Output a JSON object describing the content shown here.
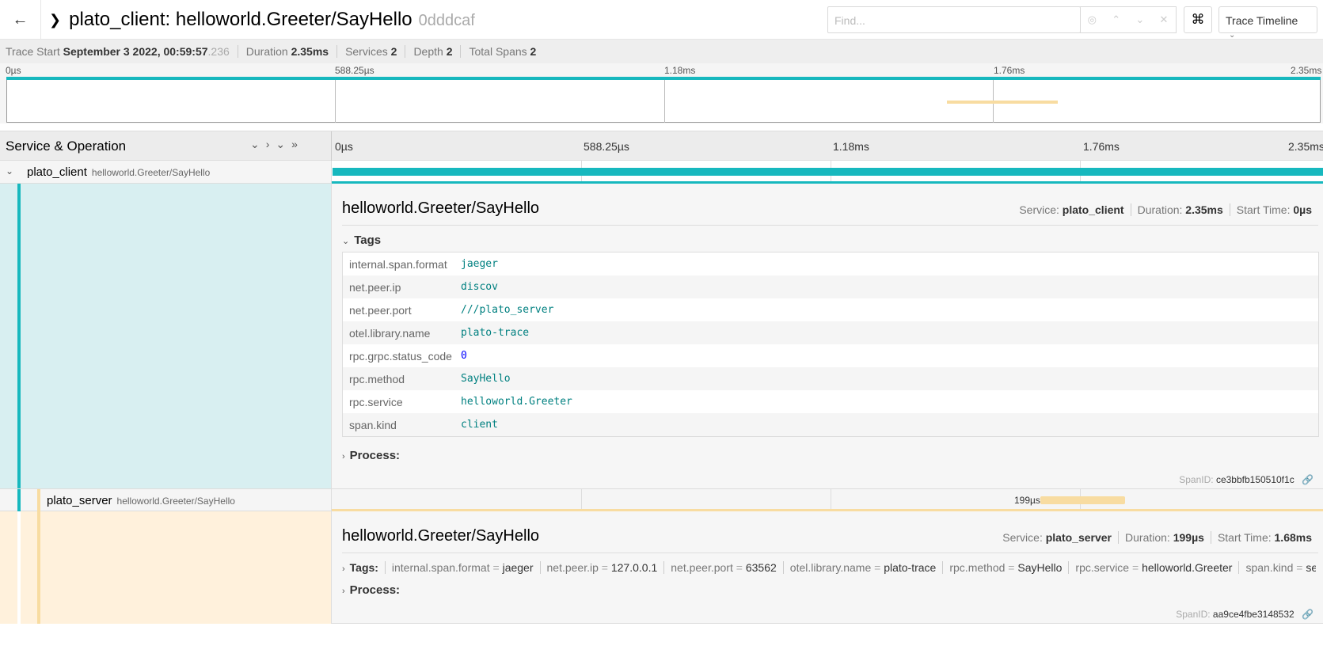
{
  "header": {
    "title_service": "plato_client: helloworld.Greeter/SayHello",
    "trace_id": "0dddcaf",
    "find_placeholder": "Find...",
    "view_label": "Trace Timeline"
  },
  "summary": {
    "trace_start_label": "Trace Start",
    "trace_start_value": "September 3 2022, 00:59:57",
    "trace_start_ms": ".236",
    "duration_label": "Duration",
    "duration_value": "2.35ms",
    "services_label": "Services",
    "services_value": "2",
    "depth_label": "Depth",
    "depth_value": "2",
    "total_spans_label": "Total Spans",
    "total_spans_value": "2"
  },
  "ticks": [
    "0µs",
    "588.25µs",
    "1.18ms",
    "1.76ms",
    "2.35ms"
  ],
  "timeline_header": {
    "label": "Service & Operation"
  },
  "spans": [
    {
      "service": "plato_client",
      "operation": "helloworld.Greeter/SayHello",
      "start_fraction": 0.0,
      "duration_fraction": 1.0,
      "color": "#17b8be",
      "detail": {
        "title": "helloworld.Greeter/SayHello",
        "service_label": "Service:",
        "service_value": "plato_client",
        "duration_label": "Duration:",
        "duration_value": "2.35ms",
        "start_label": "Start Time:",
        "start_value": "0µs",
        "tags_label": "Tags",
        "tags": [
          {
            "key": "internal.span.format",
            "value": "jaeger"
          },
          {
            "key": "net.peer.ip",
            "value": "discov"
          },
          {
            "key": "net.peer.port",
            "value": "///plato_server"
          },
          {
            "key": "otel.library.name",
            "value": "plato-trace"
          },
          {
            "key": "rpc.grpc.status_code",
            "value": "0"
          },
          {
            "key": "rpc.method",
            "value": "SayHello"
          },
          {
            "key": "rpc.service",
            "value": "helloworld.Greeter"
          },
          {
            "key": "span.kind",
            "value": "client"
          }
        ],
        "process_label": "Process:",
        "spanid_label": "SpanID:",
        "spanid_value": "ce3bbfb150510f1c"
      }
    },
    {
      "service": "plato_server",
      "operation": "helloworld.Greeter/SayHello",
      "start_fraction": 0.715,
      "duration_fraction": 0.085,
      "bar_label": "199µs",
      "color": "#f8dca1",
      "detail": {
        "title": "helloworld.Greeter/SayHello",
        "service_label": "Service:",
        "service_value": "plato_server",
        "duration_label": "Duration:",
        "duration_value": "199µs",
        "start_label": "Start Time:",
        "start_value": "1.68ms",
        "tags_label": "Tags:",
        "inline_tags": [
          {
            "key": "internal.span.format",
            "value": "jaeger"
          },
          {
            "key": "net.peer.ip",
            "value": "127.0.0.1"
          },
          {
            "key": "net.peer.port",
            "value": "63562"
          },
          {
            "key": "otel.library.name",
            "value": "plato-trace"
          },
          {
            "key": "rpc.method",
            "value": "SayHello"
          },
          {
            "key": "rpc.service",
            "value": "helloworld.Greeter"
          },
          {
            "key": "span.kind",
            "value": "server"
          }
        ],
        "process_label": "Process:",
        "spanid_label": "SpanID:",
        "spanid_value": "aa9ce4fbe3148532"
      }
    }
  ]
}
